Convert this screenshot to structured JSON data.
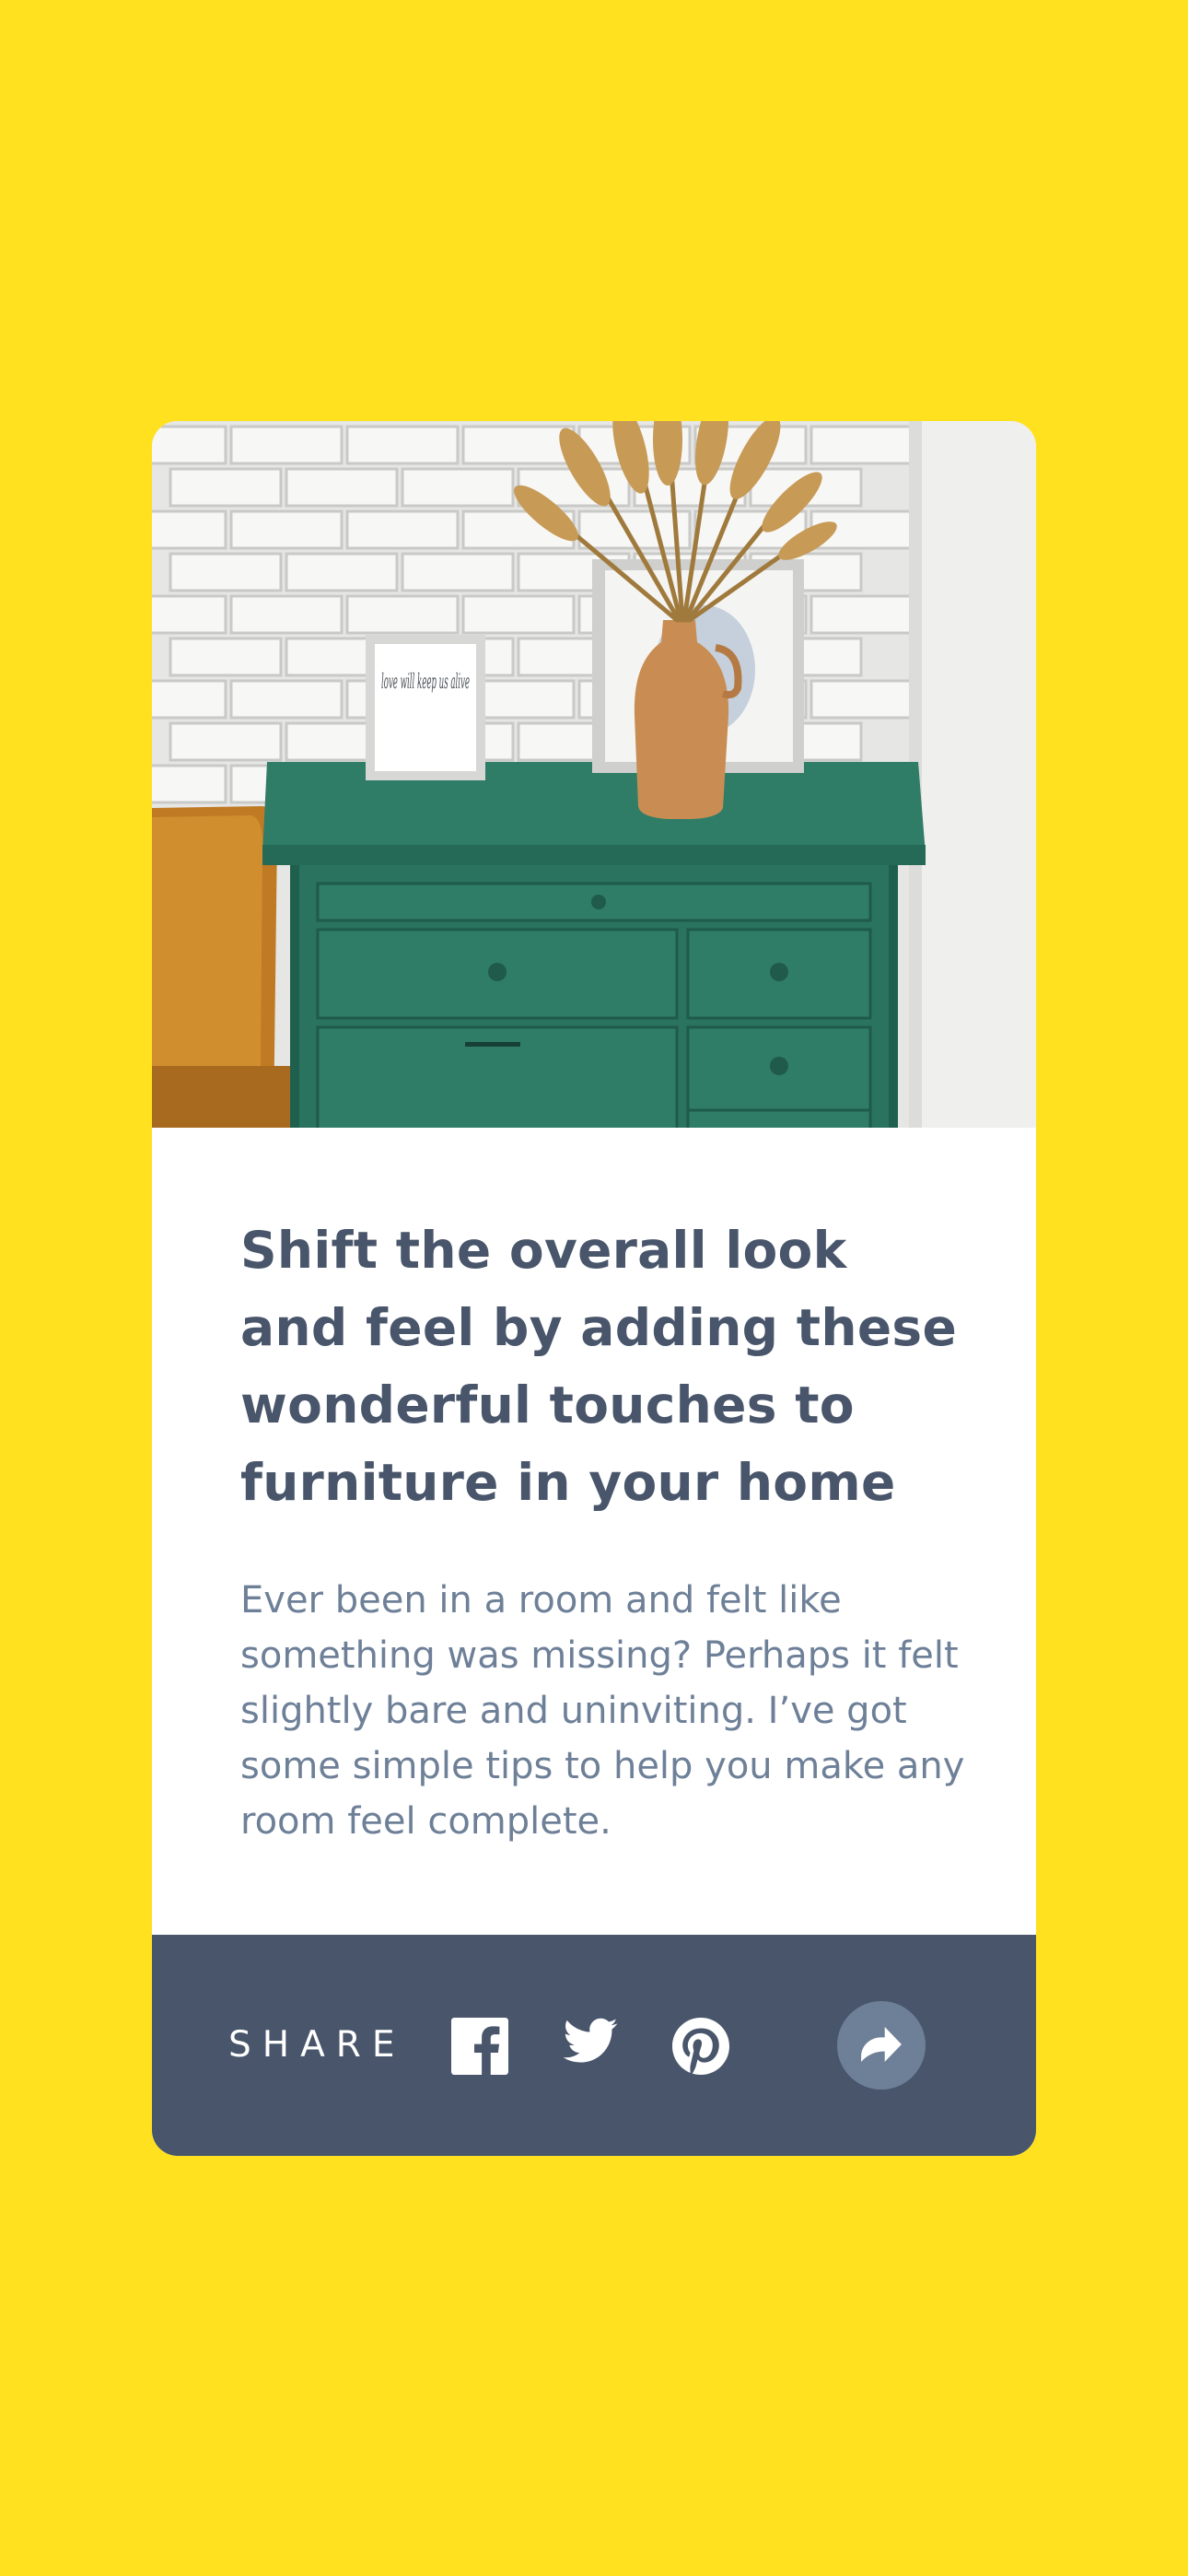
{
  "article": {
    "image_alt": "Green drawers",
    "title": "Shift the overall look and feel by adding these wonderful touches to furniture in your home",
    "description": "Ever been in a room and felt like something was missing? Perhaps it felt slightly bare and uninviting. I’ve got some simple tips to help you make any room feel complete."
  },
  "photo_frame_text": "love will keep us alive",
  "share": {
    "label": "SHARE",
    "icons": [
      "facebook-icon",
      "twitter-icon",
      "pinterest-icon",
      "share-arrow-icon"
    ]
  },
  "colors": {
    "background": "#FFE11F",
    "card": "#FFFFFF",
    "heading": "#48556A",
    "body": "#6E8098",
    "share_bar": "#48556A",
    "share_button": "#6E8098"
  }
}
